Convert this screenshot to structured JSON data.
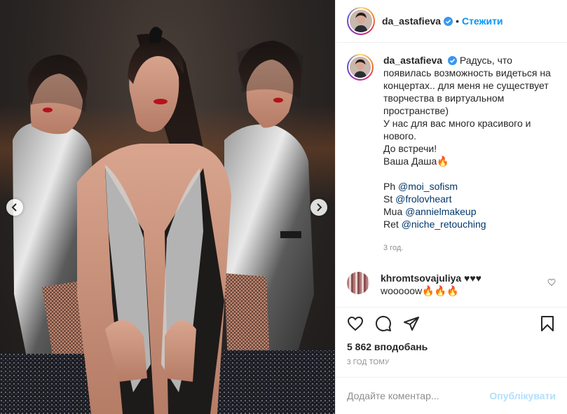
{
  "post": {
    "image_alt": "Фото",
    "author": {
      "username": "da_astafieva",
      "verified": true,
      "follow_label": "Стежити",
      "separator": "•"
    },
    "caption": {
      "username": "da_astafieva",
      "lines": [
        "Радусь, что появилась возможность видеться на концертах.. для меня не существует творчества в виртуальном пространстве)",
        "У нас для вас много красивого и нового.",
        "До встречи!",
        "Ваша Даша🔥"
      ],
      "credits": [
        {
          "prefix": "Ph ",
          "mention": "@moi_sofism"
        },
        {
          "prefix": "St ",
          "mention": "@frolovheart"
        },
        {
          "prefix": "Mua ",
          "mention": "@annielmakeup"
        },
        {
          "prefix": "Ret ",
          "mention": "@niche_retouching"
        }
      ],
      "time": "3 год."
    },
    "comment": {
      "username": "khromtsovajuliya",
      "text_inline": "♥♥♥",
      "text": "wooooow🔥🔥🔥"
    },
    "actions": {
      "like_icon": "heart-icon",
      "comment_icon": "comment-icon",
      "share_icon": "share-icon",
      "save_icon": "bookmark-icon"
    },
    "likes": "5 862 вподобань",
    "time_ago": "3 ГОД ТОМУ",
    "add_comment": {
      "placeholder": "Додайте коментар...",
      "publish_label": "Опублікувати"
    },
    "colors": {
      "link": "#0095f6",
      "mention": "#00376b",
      "muted": "#8e8e8e",
      "publish_disabled": "#b2dffc"
    }
  }
}
